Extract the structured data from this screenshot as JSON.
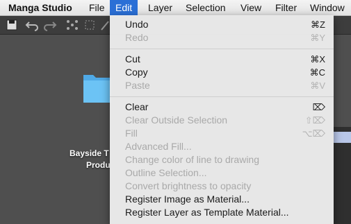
{
  "menubar": {
    "app_name": "Manga Studio",
    "items": [
      "File",
      "Edit",
      "Layer",
      "Selection",
      "View",
      "Filter",
      "Window"
    ],
    "active": "Edit"
  },
  "desktop": {
    "folder_label_line1": "Bayside T",
    "folder_label_line2": "Produ"
  },
  "edit_menu": {
    "items": [
      {
        "label": "Undo",
        "shortcut": "⌘Z",
        "enabled": true
      },
      {
        "label": "Redo",
        "shortcut": "⌘Y",
        "enabled": false
      },
      {
        "label": "Cut",
        "shortcut": "⌘X",
        "enabled": true
      },
      {
        "label": "Copy",
        "shortcut": "⌘C",
        "enabled": true
      },
      {
        "label": "Paste",
        "shortcut": "⌘V",
        "enabled": false
      },
      {
        "label": "Clear",
        "shortcut": "⌦",
        "enabled": true
      },
      {
        "label": "Clear Outside Selection",
        "shortcut": "⇧⌦",
        "enabled": false
      },
      {
        "label": "Fill",
        "shortcut": "⌥⌦",
        "enabled": false
      },
      {
        "label": "Advanced Fill...",
        "shortcut": "",
        "enabled": false
      },
      {
        "label": "Change color of line to drawing",
        "shortcut": "",
        "enabled": false
      },
      {
        "label": "Outline Selection...",
        "shortcut": "",
        "enabled": false
      },
      {
        "label": "Convert brightness to opacity",
        "shortcut": "",
        "enabled": false
      },
      {
        "label": "Register Image as Material...",
        "shortcut": "",
        "enabled": true
      },
      {
        "label": "Register Layer as Template Material...",
        "shortcut": "",
        "enabled": true
      }
    ]
  },
  "colors": {
    "menu_highlight": "#2a6fd6",
    "desktop_bg": "#4f4f4f",
    "folder_blue": "#5bb6ee"
  }
}
